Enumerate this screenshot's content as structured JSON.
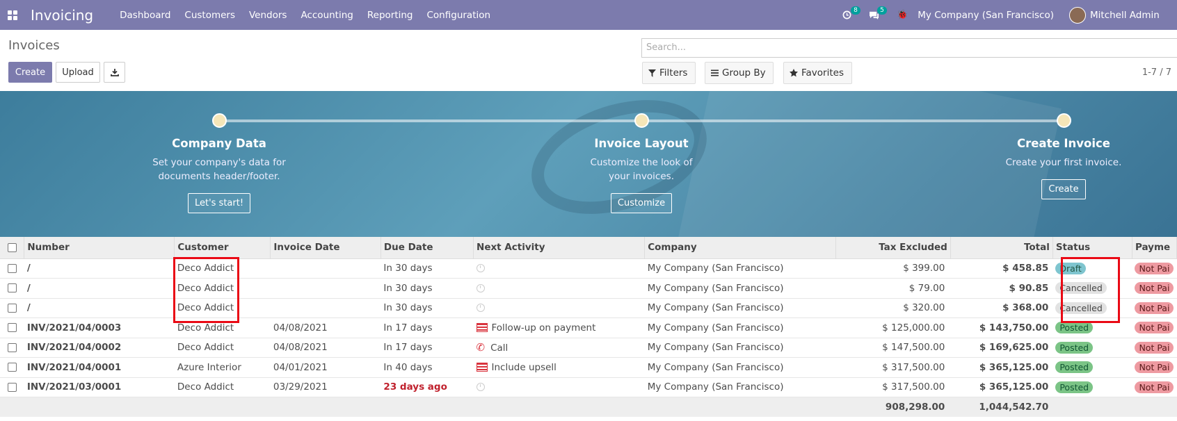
{
  "nav": {
    "brand": "Invoicing",
    "menu": [
      "Dashboard",
      "Customers",
      "Vendors",
      "Accounting",
      "Reporting",
      "Configuration"
    ],
    "activity_count": "8",
    "message_count": "5",
    "company": "My Company (San Francisco)",
    "user": "Mitchell Admin"
  },
  "control": {
    "title": "Invoices",
    "create": "Create",
    "upload": "Upload",
    "search_placeholder": "Search...",
    "filters": "Filters",
    "group_by": "Group By",
    "favorites": "Favorites",
    "pager": "1-7 / 7"
  },
  "onboarding": [
    {
      "title": "Company Data",
      "desc": "Set your company's data for documents header/footer.",
      "button": "Let's start!"
    },
    {
      "title": "Invoice Layout",
      "desc": "Customize the look of your invoices.",
      "button": "Customize"
    },
    {
      "title": "Create Invoice",
      "desc": "Create your first invoice.",
      "button": "Create"
    }
  ],
  "table": {
    "columns": [
      "Number",
      "Customer",
      "Invoice Date",
      "Due Date",
      "Next Activity",
      "Company",
      "Tax Excluded",
      "Total",
      "Status",
      "Payme"
    ],
    "rows": [
      {
        "number": "/",
        "customer": "Deco Addict",
        "date": "",
        "due": "In 30 days",
        "activity": "",
        "activity_icon": "clock-icon",
        "company": "My Company (San Francisco)",
        "tax_excl": "$ 399.00",
        "total": "$ 458.85",
        "status": "Draft",
        "payment": "Not Pai"
      },
      {
        "number": "/",
        "customer": "Deco Addict",
        "date": "",
        "due": "In 30 days",
        "activity": "",
        "activity_icon": "clock-icon",
        "company": "My Company (San Francisco)",
        "tax_excl": "$ 79.00",
        "total": "$ 90.85",
        "status": "Cancelled",
        "payment": "Not Pai"
      },
      {
        "number": "/",
        "customer": "Deco Addict",
        "date": "",
        "due": "In 30 days",
        "activity": "",
        "activity_icon": "clock-icon",
        "company": "My Company (San Francisco)",
        "tax_excl": "$ 320.00",
        "total": "$ 368.00",
        "status": "Cancelled",
        "payment": "Not Pai"
      },
      {
        "number": "INV/2021/04/0003",
        "customer": "Deco Addict",
        "date": "04/08/2021",
        "due": "In 17 days",
        "activity": "Follow-up on payment",
        "activity_icon": "task-icon",
        "company": "My Company (San Francisco)",
        "tax_excl": "$ 125,000.00",
        "total": "$ 143,750.00",
        "status": "Posted",
        "payment": "Not Pai"
      },
      {
        "number": "INV/2021/04/0002",
        "customer": "Deco Addict",
        "date": "04/08/2021",
        "due": "In 17 days",
        "activity": "Call",
        "activity_icon": "phone-icon",
        "company": "My Company (San Francisco)",
        "tax_excl": "$ 147,500.00",
        "total": "$ 169,625.00",
        "status": "Posted",
        "payment": "Not Pai"
      },
      {
        "number": "INV/2021/04/0001",
        "customer": "Azure Interior",
        "date": "04/01/2021",
        "due": "In 40 days",
        "activity": "Include upsell",
        "activity_icon": "task-icon",
        "company": "My Company (San Francisco)",
        "tax_excl": "$ 317,500.00",
        "total": "$ 365,125.00",
        "status": "Posted",
        "payment": "Not Pai"
      },
      {
        "number": "INV/2021/03/0001",
        "customer": "Deco Addict",
        "date": "03/29/2021",
        "due": "23 days ago",
        "activity": "",
        "activity_icon": "clock-icon",
        "company": "My Company (San Francisco)",
        "tax_excl": "$ 317,500.00",
        "total": "$ 365,125.00",
        "status": "Posted",
        "payment": "Not Pai"
      }
    ],
    "totals": {
      "tax_excl": "908,298.00",
      "total": "1,044,542.70"
    }
  }
}
